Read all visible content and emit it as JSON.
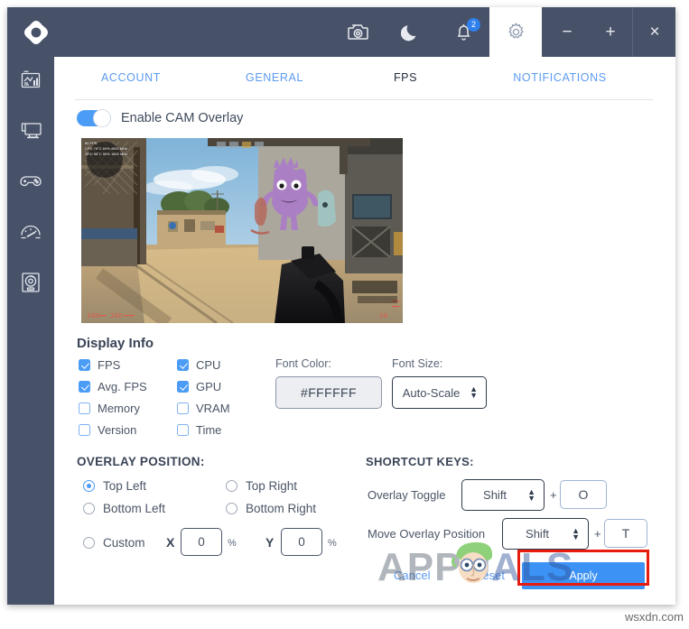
{
  "window": {
    "logo_icon": "nzxt-cam-logo",
    "titlebar_icons": [
      {
        "name": "camera-icon",
        "label": "Screenshot"
      },
      {
        "name": "moon-icon",
        "label": "Dark Mode"
      },
      {
        "name": "bell-icon",
        "label": "Notifications",
        "badge": "2"
      },
      {
        "name": "gear-icon",
        "label": "Settings",
        "active": true
      }
    ],
    "controls": {
      "minimize": "−",
      "maximize": "+",
      "close": "×"
    }
  },
  "sidebar": {
    "items": [
      {
        "name": "sidebar-item-dashboard",
        "icon": "dashboard-icon"
      },
      {
        "name": "sidebar-item-pc-monitoring",
        "icon": "monitor-icon"
      },
      {
        "name": "sidebar-item-games",
        "icon": "gamepad-icon"
      },
      {
        "name": "sidebar-item-tuning",
        "icon": "speedometer-icon"
      },
      {
        "name": "sidebar-item-lighting",
        "icon": "disc-icon"
      }
    ]
  },
  "tabs": [
    {
      "label": "ACCOUNT",
      "active": false
    },
    {
      "label": "GENERAL",
      "active": false
    },
    {
      "label": "FPS",
      "active": true
    },
    {
      "label": "NOTIFICATIONS",
      "active": false
    }
  ],
  "overlay_toggle": {
    "label": "Enable CAM Overlay",
    "enabled": true
  },
  "preview": {
    "overlay_lines": [
      "60 FPS",
      "CPU 78°C 60% 4000 MHz",
      "GPU 58°C 50% 1800 MHz"
    ]
  },
  "display_info": {
    "heading": "Display Info",
    "options": [
      {
        "label": "FPS",
        "checked": true
      },
      {
        "label": "Avg. FPS",
        "checked": true
      },
      {
        "label": "Memory",
        "checked": false
      },
      {
        "label": "Version",
        "checked": false
      },
      {
        "label": "CPU",
        "checked": true
      },
      {
        "label": "GPU",
        "checked": true
      },
      {
        "label": "VRAM",
        "checked": false
      },
      {
        "label": "Time",
        "checked": false
      }
    ],
    "font_color": {
      "label": "Font Color:",
      "value": "#FFFFFF"
    },
    "font_size": {
      "label": "Font Size:",
      "value": "Auto-Scale"
    }
  },
  "overlay_position": {
    "heading": "OVERLAY POSITION:",
    "options": [
      {
        "label": "Top Left",
        "selected": true
      },
      {
        "label": "Top Right",
        "selected": false
      },
      {
        "label": "Bottom Left",
        "selected": false
      },
      {
        "label": "Bottom Right",
        "selected": false
      },
      {
        "label": "Custom",
        "selected": false
      }
    ],
    "custom": {
      "x_label": "X",
      "x_value": "0",
      "y_label": "Y",
      "y_value": "0",
      "unit": "%"
    }
  },
  "shortcut_keys": {
    "heading": "SHORTCUT KEYS:",
    "rows": [
      {
        "label": "Overlay Toggle",
        "modifier": "Shift",
        "plus": "+",
        "key": "O"
      },
      {
        "label": "Move Overlay Position",
        "modifier": "Shift",
        "plus": "+",
        "key": "T"
      }
    ]
  },
  "footer": {
    "cancel": "Cancel",
    "reset": "Reset",
    "apply": "Apply"
  },
  "watermarks": {
    "brand_a": "A",
    "brand_pp": "PP",
    "brand_uals": "UALS",
    "site": "wsxdn.com"
  },
  "colors": {
    "chrome": "#475168",
    "accent": "#4b9cf5",
    "link": "#5b9bf0",
    "highlight": "#e81b0f"
  }
}
